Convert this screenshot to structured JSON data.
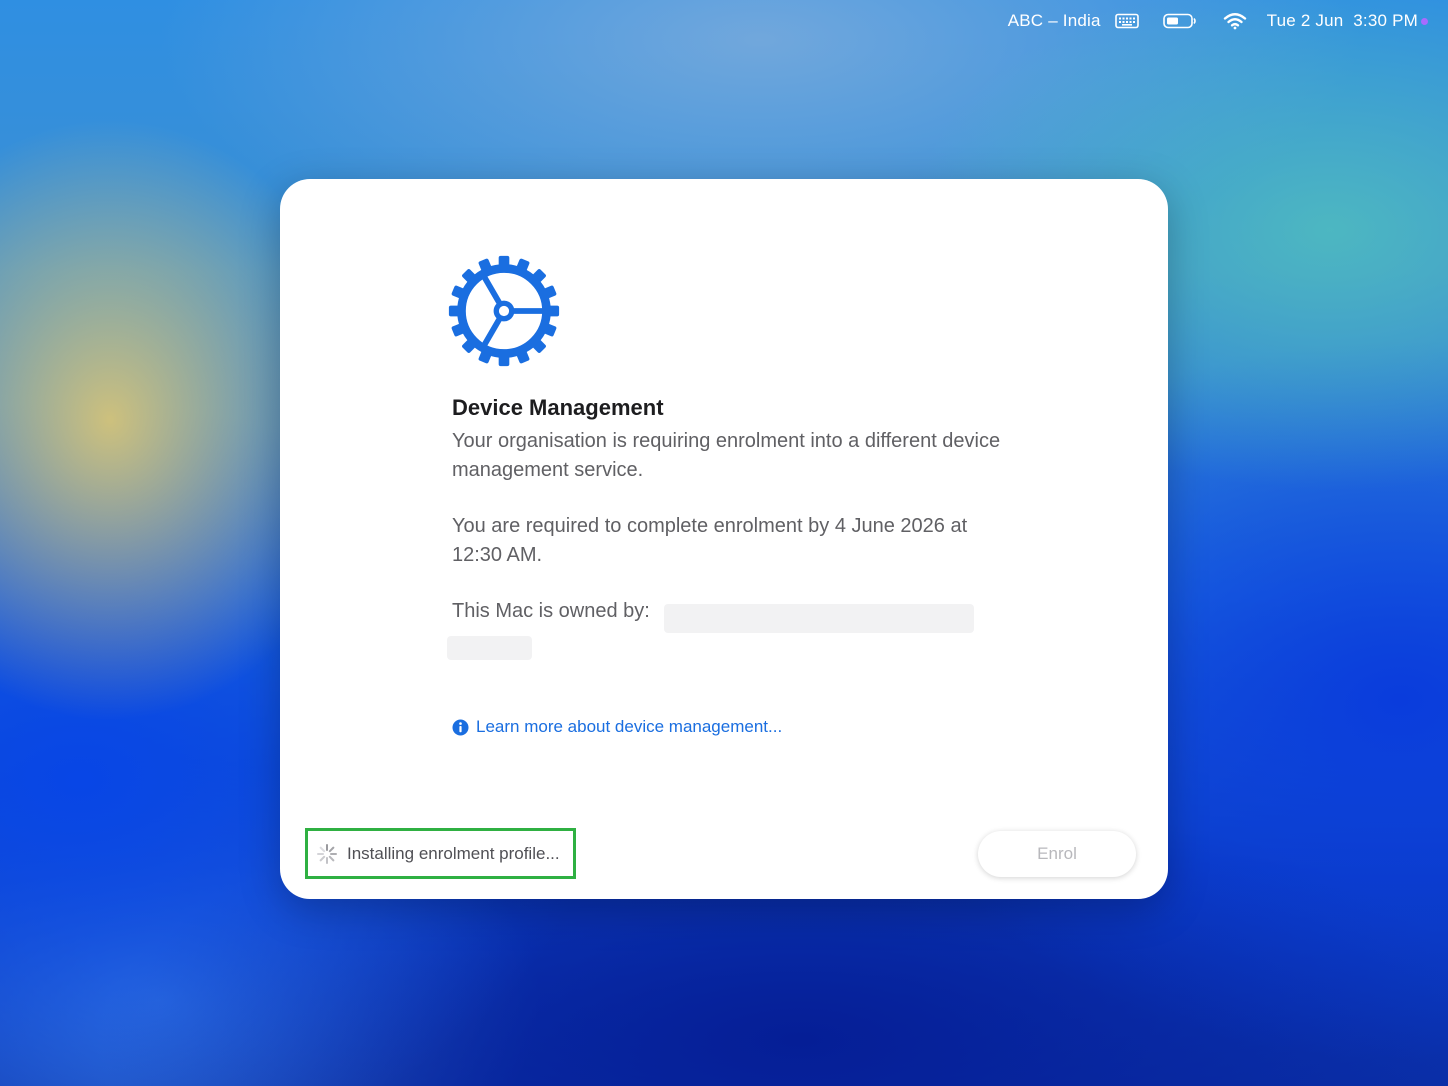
{
  "menubar": {
    "input_source": "ABC – India",
    "keyboard_icon": "keyboard-icon",
    "battery_icon": "battery-icon",
    "wifi_icon": "wifi-icon",
    "datetime": "Tue 2 Jun  3:30 PM"
  },
  "dialog": {
    "icon": "gear-icon",
    "accent_color": "#1a6ee0",
    "title": "Device Management",
    "description": "Your organisation is requiring enrolment into a different device management service.",
    "deadline": "You are required to complete enrolment by 4 June 2026 at 12:30 AM.",
    "owner_label": "This Mac is owned by:",
    "learn_more": "Learn more about device management...",
    "status_text": "Installing enrolment profile...",
    "status_highlight_color": "#2fb042",
    "enrol_button": "Enrol"
  }
}
